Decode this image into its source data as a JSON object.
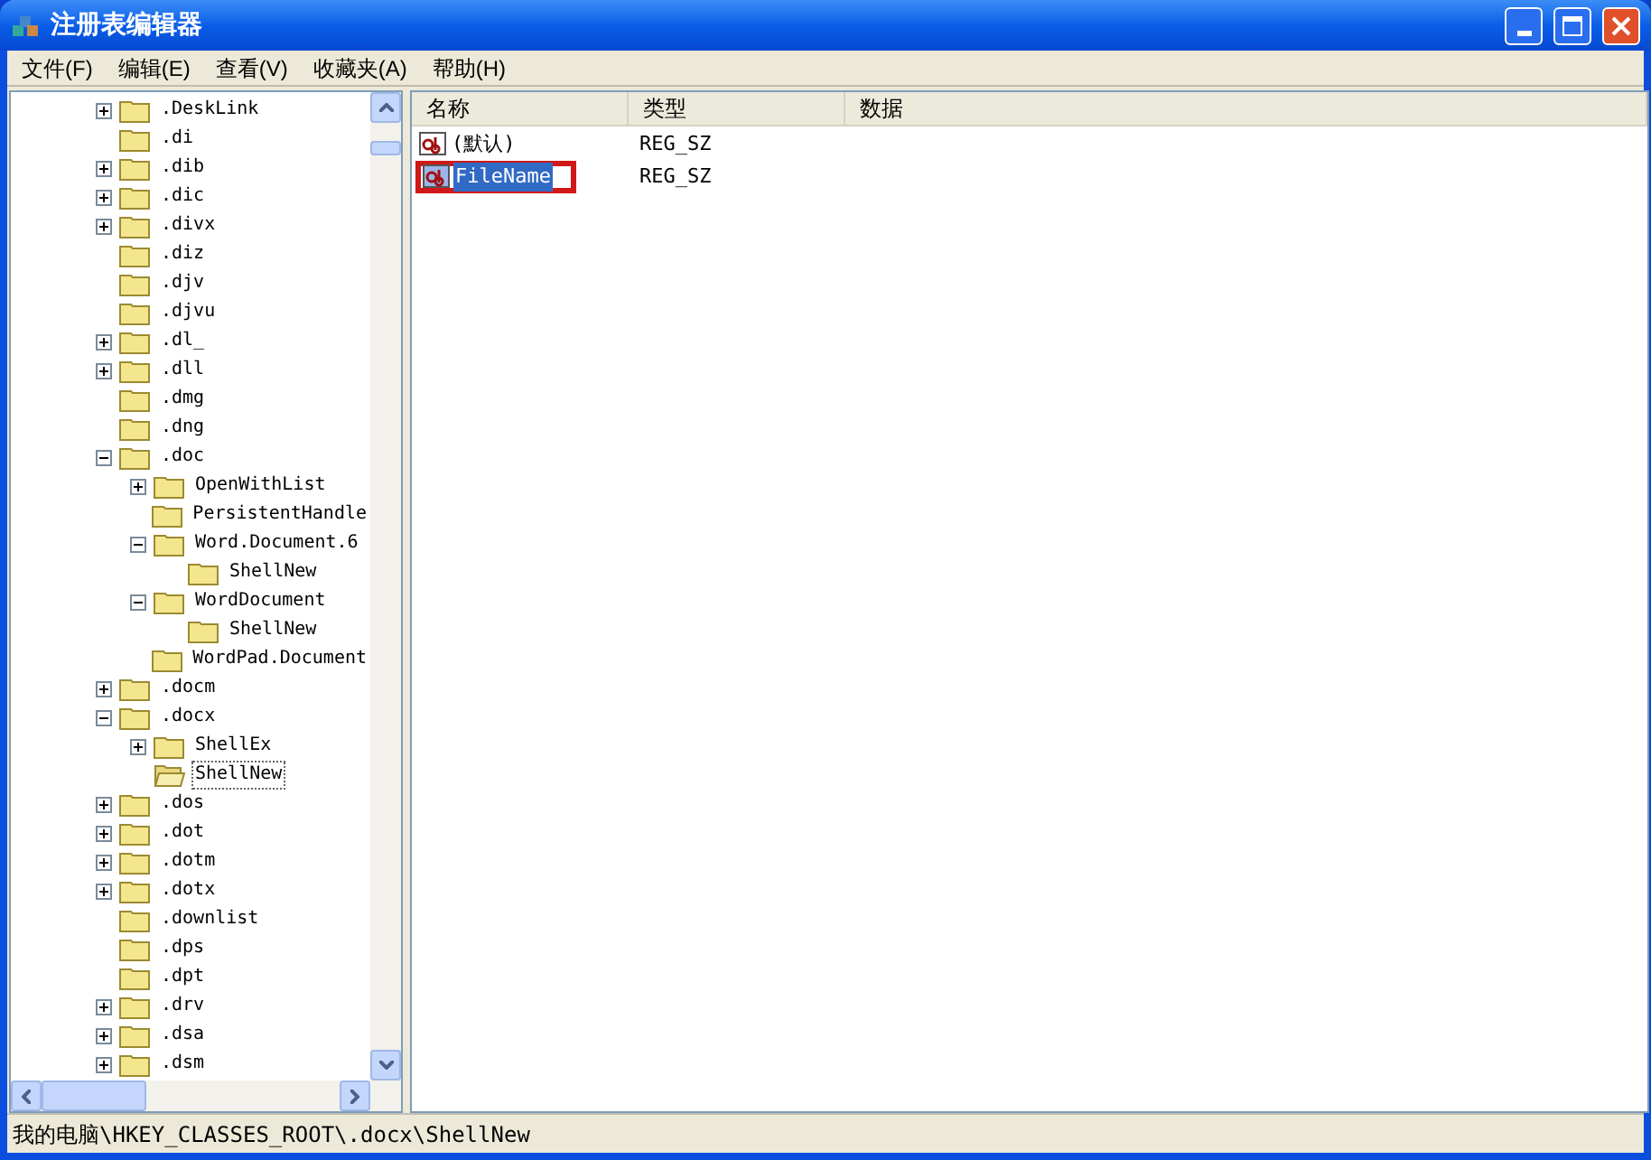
{
  "window": {
    "title": "注册表编辑器"
  },
  "menu": [
    "文件(F)",
    "编辑(E)",
    "查看(V)",
    "收藏夹(A)",
    "帮助(H)"
  ],
  "tree": [
    {
      "label": ".DeskLink",
      "expanded": false,
      "selected": false
    },
    {
      "label": ".di",
      "selected": false
    },
    {
      "label": ".dib",
      "expanded": false,
      "selected": false
    },
    {
      "label": ".dic",
      "expanded": false,
      "selected": false
    },
    {
      "label": ".divx",
      "expanded": false,
      "selected": false
    },
    {
      "label": ".diz",
      "selected": false
    },
    {
      "label": ".djv",
      "selected": false
    },
    {
      "label": ".djvu",
      "selected": false
    },
    {
      "label": ".dl_",
      "expanded": false,
      "selected": false
    },
    {
      "label": ".dll",
      "expanded": false,
      "selected": false
    },
    {
      "label": ".dmg",
      "selected": false
    },
    {
      "label": ".dng",
      "selected": false
    },
    {
      "label": ".doc",
      "expanded": true,
      "selected": false,
      "children": [
        {
          "label": "OpenWithList",
          "expanded": false,
          "selected": false
        },
        {
          "label": "PersistentHandle",
          "selected": false
        },
        {
          "label": "Word.Document.6",
          "expanded": true,
          "selected": false,
          "children": [
            {
              "label": "ShellNew",
              "selected": false
            }
          ]
        },
        {
          "label": "WordDocument",
          "expanded": true,
          "selected": false,
          "children": [
            {
              "label": "ShellNew",
              "selected": false
            }
          ]
        },
        {
          "label": "WordPad.Document",
          "selected": false
        }
      ]
    },
    {
      "label": ".docm",
      "expanded": false,
      "selected": false
    },
    {
      "label": ".docx",
      "expanded": true,
      "selected": false,
      "children": [
        {
          "label": "ShellEx",
          "expanded": false,
          "selected": false
        },
        {
          "label": "ShellNew",
          "selected": true
        }
      ]
    },
    {
      "label": ".dos",
      "expanded": false,
      "selected": false
    },
    {
      "label": ".dot",
      "expanded": false,
      "selected": false
    },
    {
      "label": ".dotm",
      "expanded": false,
      "selected": false
    },
    {
      "label": ".dotx",
      "expanded": false,
      "selected": false
    },
    {
      "label": ".downlist",
      "selected": false
    },
    {
      "label": ".dps",
      "selected": false
    },
    {
      "label": ".dpt",
      "selected": false
    },
    {
      "label": ".drv",
      "expanded": false,
      "selected": false
    },
    {
      "label": ".dsa",
      "expanded": false,
      "selected": false
    },
    {
      "label": ".dsm",
      "expanded": false,
      "selected": false
    }
  ],
  "table": {
    "columns": [
      "名称",
      "类型",
      "数据"
    ],
    "rows": [
      {
        "name": "(默认)",
        "type": "REG_SZ",
        "selected": false,
        "marked": false
      },
      {
        "name": "FileName",
        "type": "REG_SZ",
        "selected": true,
        "marked": true
      }
    ]
  },
  "status_bar": "我的电脑\\HKEY_CLASSES_ROOT\\.docx\\ShellNew"
}
